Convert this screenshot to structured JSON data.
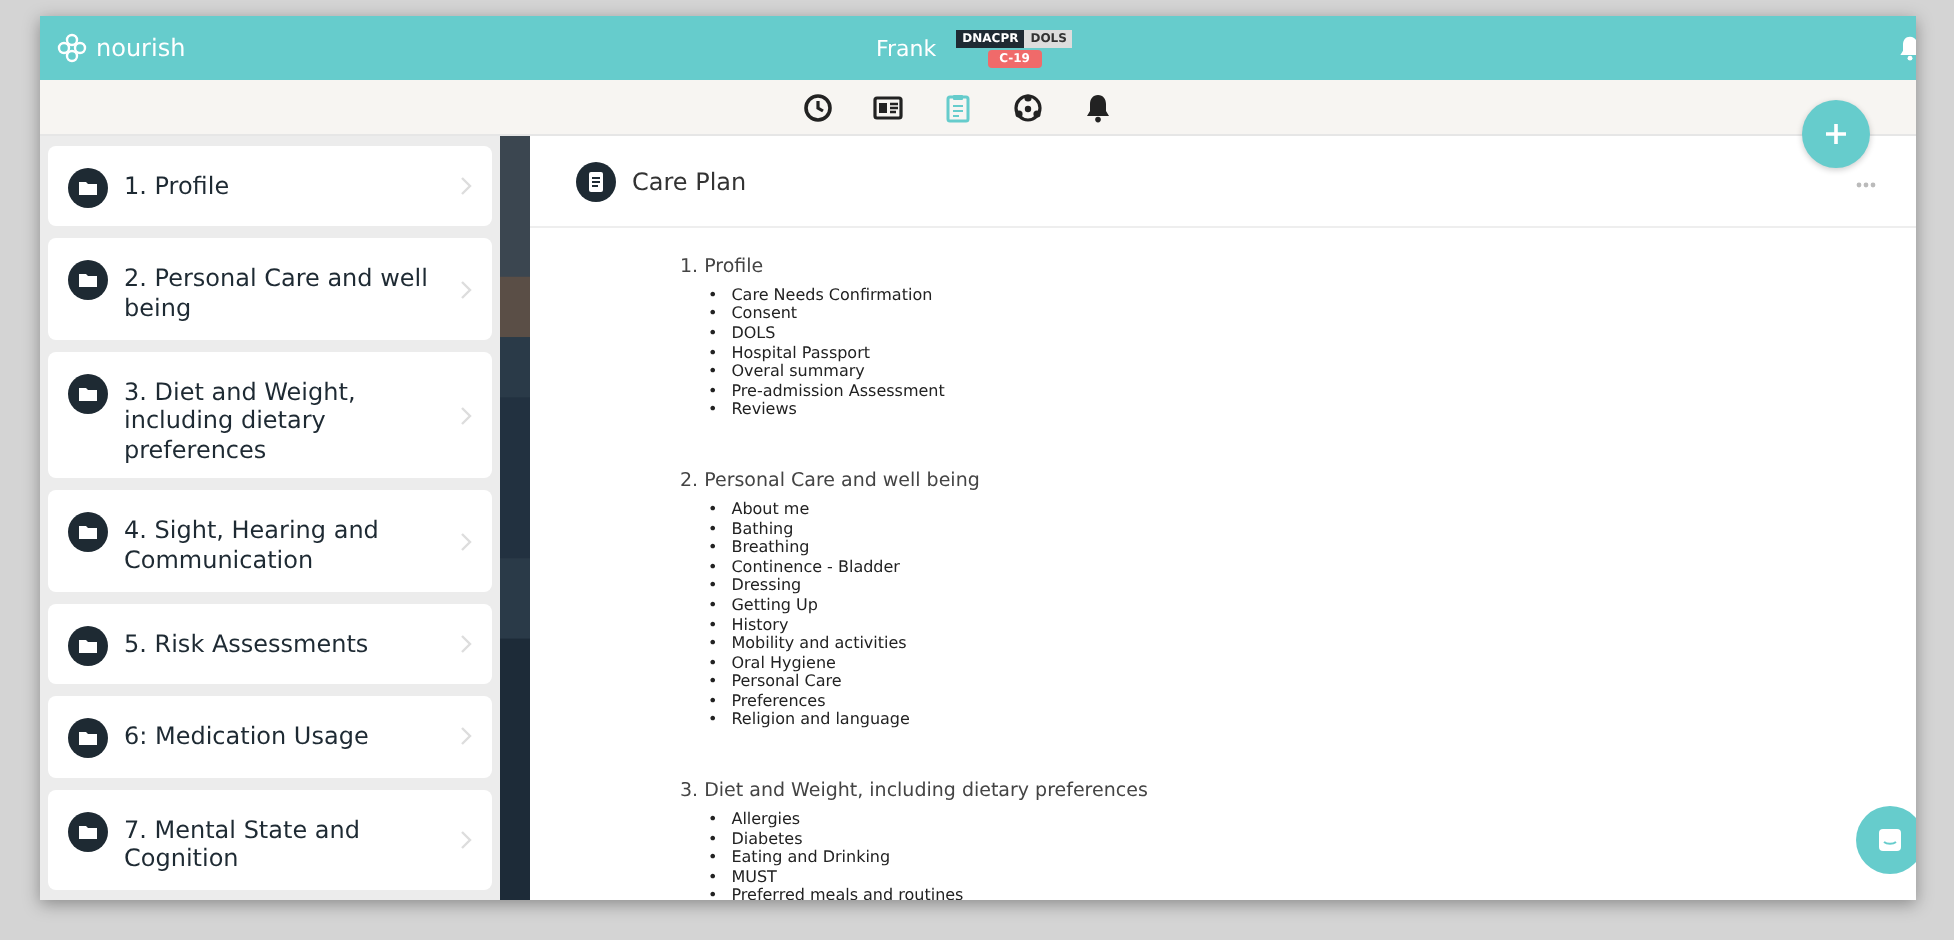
{
  "header": {
    "logo": "nourish",
    "resident": "Frank",
    "badges": [
      {
        "label": "DNACPR",
        "kind": "dark"
      },
      {
        "label": "DOLS",
        "kind": "grey"
      },
      {
        "label": "C-19",
        "kind": "alert"
      }
    ]
  },
  "nav_tabs": [
    {
      "kind": "clock",
      "selected": false
    },
    {
      "kind": "id-card",
      "selected": false
    },
    {
      "kind": "clipboard",
      "selected": true
    },
    {
      "kind": "network",
      "selected": false
    },
    {
      "kind": "bell",
      "selected": false
    }
  ],
  "sidebar": {
    "items": [
      {
        "label": "1. Profile"
      },
      {
        "label": "2. Personal Care and well being"
      },
      {
        "label": "3. Diet and Weight, including dietary preferences"
      },
      {
        "label": "4. Sight, Hearing and Communication"
      },
      {
        "label": "5. Risk Assessments"
      },
      {
        "label": "6: Medication Usage"
      },
      {
        "label": "7. Mental State and Cognition"
      }
    ]
  },
  "content": {
    "title": "Care Plan",
    "bullet": "•",
    "sections": [
      {
        "heading": "1. Profile",
        "items": [
          "Care Needs Confirmation",
          "Consent",
          "DOLS",
          "Hospital Passport",
          "Overal summary",
          "Pre-admission Assessment",
          "Reviews"
        ]
      },
      {
        "heading": "2. Personal Care and well being",
        "items": [
          "About me",
          "Bathing",
          "Breathing",
          "Continence - Bladder",
          "Dressing",
          "Getting Up",
          "History",
          "Mobility and activities",
          "Oral Hygiene",
          "Personal Care",
          "Preferences",
          "Religion and language"
        ]
      },
      {
        "heading": "3. Diet and Weight, including dietary preferences",
        "items": [
          "Allergies",
          "Diabetes",
          "Eating and Drinking",
          "MUST",
          "Preferred meals and routines"
        ]
      }
    ]
  }
}
